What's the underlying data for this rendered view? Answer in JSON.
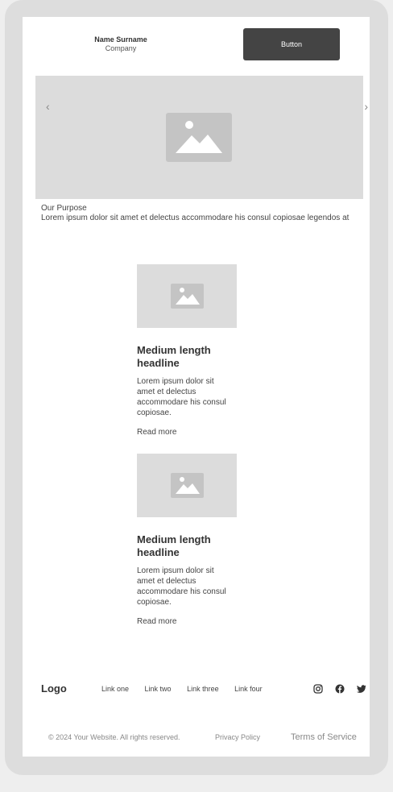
{
  "header": {
    "name": "Name Surname",
    "company": "Company",
    "button_label": "Button"
  },
  "hero": {
    "prev_icon": "chevron-left-icon",
    "next_icon": "chevron-right-icon",
    "image_icon": "image-placeholder-icon"
  },
  "purpose": {
    "title": "Our Purpose",
    "text": "Lorem ipsum dolor sit amet et delectus accommodare his consul copiosae legendos at"
  },
  "cards": [
    {
      "headline": "Medium length headline",
      "body": "Lorem ipsum dolor sit amet et delectus accommodare his consul copiosae.",
      "link": "Read more"
    },
    {
      "headline": "Medium length headline",
      "body": "Lorem ipsum dolor sit amet et delectus accommodare his consul copiosae.",
      "link": "Read more"
    }
  ],
  "footer": {
    "logo": "Logo",
    "links": [
      "Link one",
      "Link two",
      "Link three",
      "Link four"
    ],
    "social_icons": [
      "instagram-icon",
      "facebook-icon",
      "twitter-icon"
    ],
    "copyright": "© 2024 Your Website. All rights reserved.",
    "privacy": "Privacy Policy",
    "terms": "Terms of Service"
  },
  "colors": {
    "button_bg": "#444444",
    "placeholder_bg": "#dcdcdc",
    "frame_bg": "#dddddd"
  }
}
